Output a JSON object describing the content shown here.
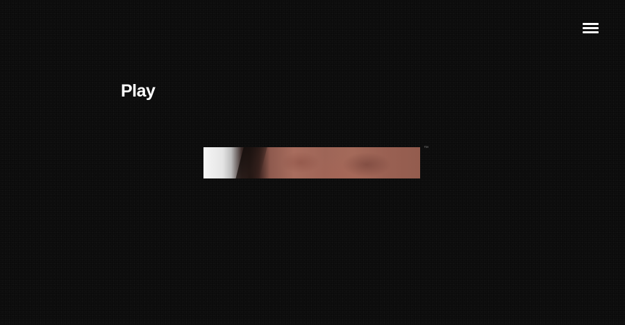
{
  "header": {
    "menu_icon": "hamburger-menu-icon"
  },
  "main": {
    "play_label": "Play",
    "trademark": "™"
  },
  "colors": {
    "background": "#0b0b0b",
    "text": "#ffffff"
  }
}
